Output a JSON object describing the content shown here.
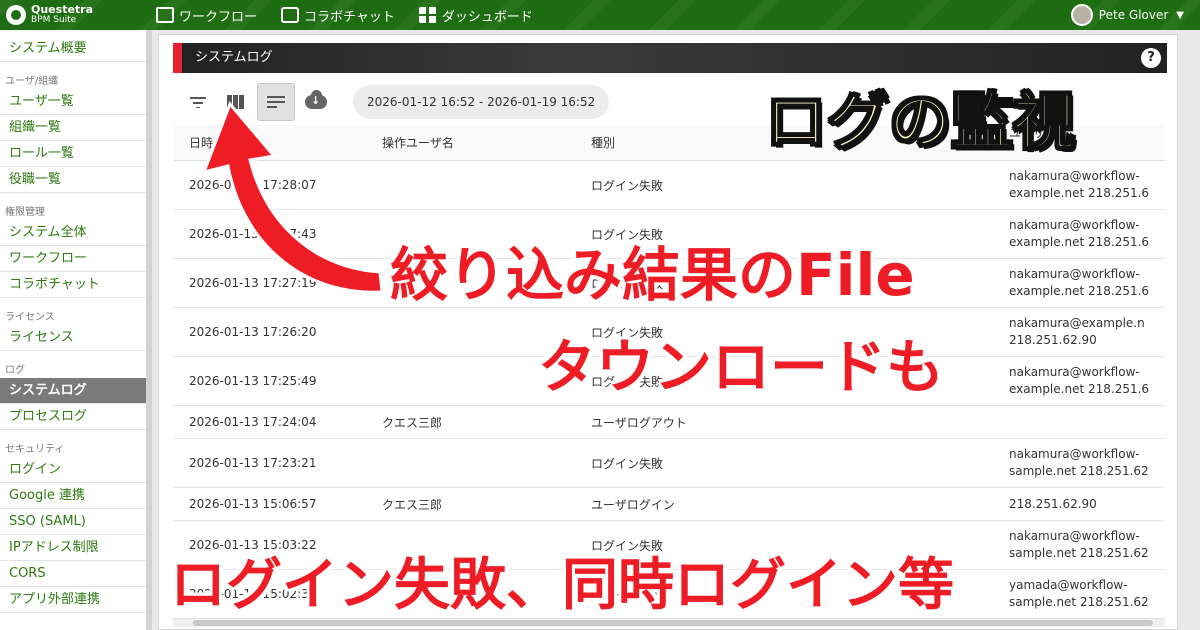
{
  "brand": {
    "name": "Questetra",
    "sub": "BPM Suite"
  },
  "topnav": [
    {
      "label": "ワークフロー",
      "icon": "workflow-icon"
    },
    {
      "label": "コラボチャット",
      "icon": "chat-icon"
    },
    {
      "label": "ダッシュボード",
      "icon": "dashboard-icon"
    }
  ],
  "user": {
    "name": "Pete Glover"
  },
  "sidebar": {
    "overview": "システム概要",
    "groups": [
      {
        "title": "ユーザ/組織",
        "items": [
          "ユーザ一覧",
          "組織一覧",
          "ロール一覧",
          "役職一覧"
        ]
      },
      {
        "title": "権限管理",
        "items": [
          "システム全体",
          "ワークフロー",
          "コラボチャット"
        ]
      },
      {
        "title": "ライセンス",
        "items": [
          "ライセンス"
        ]
      },
      {
        "title": "ログ",
        "items": [
          "システムログ",
          "プロセスログ"
        ]
      },
      {
        "title": "セキュリティ",
        "items": [
          "ログイン",
          "Google 連携",
          "SSO (SAML)",
          "IPアドレス制限",
          "CORS",
          "アプリ外部連携"
        ]
      }
    ],
    "active": "システムログ"
  },
  "page": {
    "title": "システムログ",
    "help": "?"
  },
  "toolbar": {
    "date_range": "2026-01-12 16:52 - 2026-01-19 16:52"
  },
  "table": {
    "headers": [
      "日時",
      "操作ユーザ名",
      "種別",
      "ユーザ"
    ],
    "rows": [
      {
        "date": "2026-01-13 17:28:07",
        "user": "",
        "type": "ログイン失敗",
        "detail": "nakamura@workflow-\nexample.net 218.251.6"
      },
      {
        "date": "2026-01-13 17:27:43",
        "user": "",
        "type": "ログイン失敗",
        "detail": "nakamura@workflow-\nexample.net 218.251.6"
      },
      {
        "date": "2026-01-13 17:27:19",
        "user": "",
        "type": "ログイン失敗",
        "detail": "nakamura@workflow-\nexample.net 218.251.6"
      },
      {
        "date": "2026-01-13 17:26:20",
        "user": "",
        "type": "ログイン失敗",
        "detail": "nakamura@example.n\n218.251.62.90"
      },
      {
        "date": "2026-01-13 17:25:49",
        "user": "",
        "type": "ログイン失敗",
        "detail": "nakamura@workflow-\nexample.net 218.251.6"
      },
      {
        "date": "2026-01-13 17:24:04",
        "user": "クエス三郎",
        "type": "ユーザログアウト",
        "detail": ""
      },
      {
        "date": "2026-01-13 17:23:21",
        "user": "",
        "type": "ログイン失敗",
        "detail": "nakamura@workflow-\nsample.net 218.251.62"
      },
      {
        "date": "2026-01-13 15:06:57",
        "user": "クエス三郎",
        "type": "ユーザログイン",
        "detail": "218.251.62.90"
      },
      {
        "date": "2026-01-13 15:03:22",
        "user": "",
        "type": "ログイン失敗",
        "detail": "nakamura@workflow-\nsample.net 218.251.62"
      },
      {
        "date": "2026-01-13 15:02:35",
        "user": "",
        "type": "ログイン失敗",
        "detail": "yamada@workflow-\nsample.net 218.251.62"
      }
    ]
  },
  "overlay": {
    "title": "ログの監視",
    "line1": "絞り込み結果のFile",
    "line2": "タウンロードも",
    "bottom": "ログイン失敗、同時ログイン等"
  }
}
